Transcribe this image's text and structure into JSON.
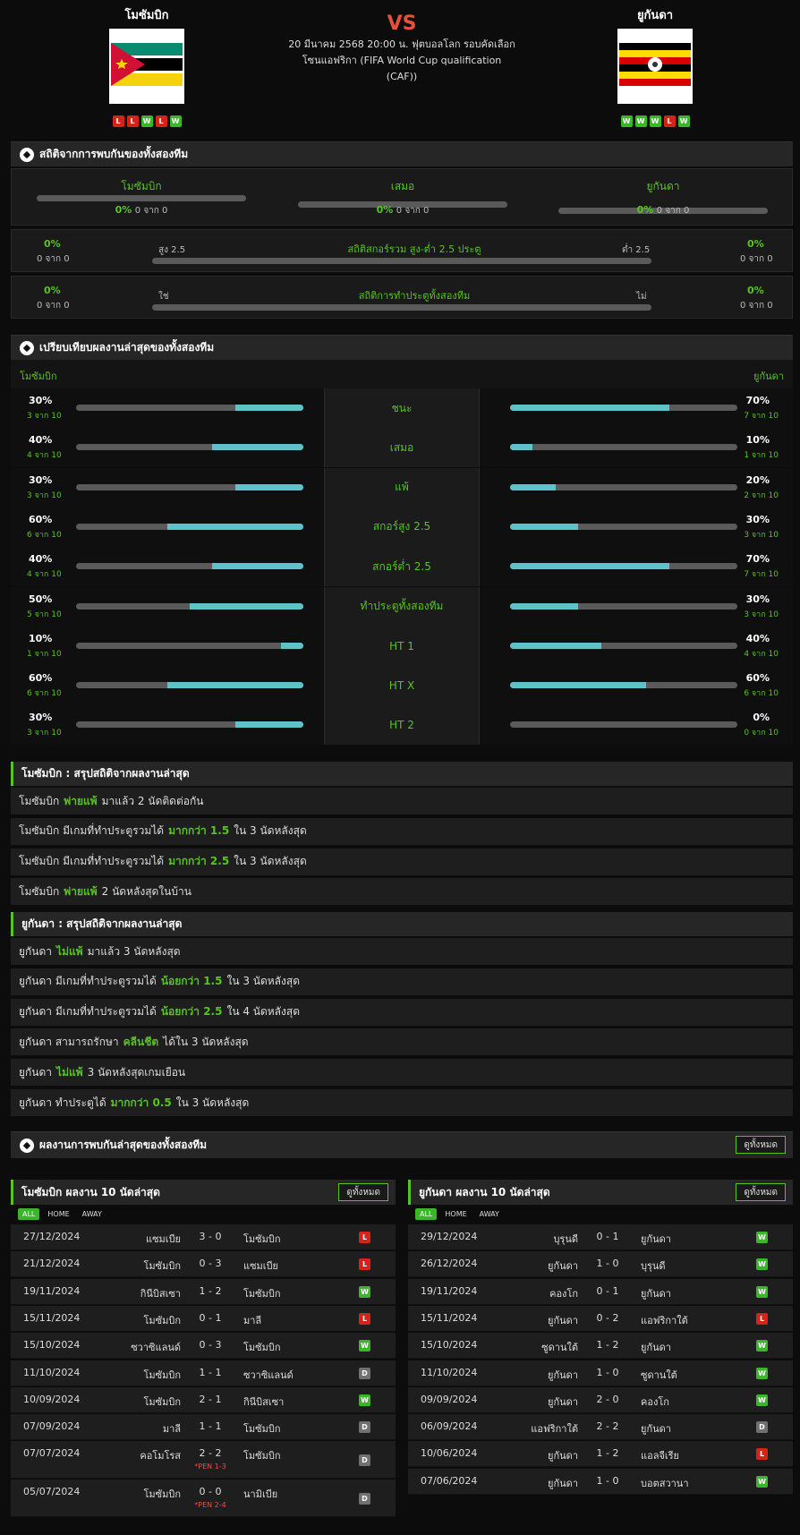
{
  "header": {
    "home_team": "โมซัมบิก",
    "away_team": "ยูกันดา",
    "vs": "VS",
    "match_info": "20 มีนาคม 2568 20:00 น. ฟุตบอลโลก รอบคัดเลือก โซนแอฟริกา (FIFA World Cup qualification (CAF))",
    "home_form": [
      "L",
      "L",
      "W",
      "L",
      "W"
    ],
    "away_form": [
      "W",
      "W",
      "W",
      "L",
      "W"
    ]
  },
  "h2h": {
    "title": "สถิติจากการพบกันของทั้งสองทีม",
    "cols": [
      {
        "label": "โมซัมบิก",
        "pct": "0%",
        "count": "0 จาก 0"
      },
      {
        "label": "เสมอ",
        "pct": "0%",
        "count": "0 จาก 0"
      },
      {
        "label": "ยูกันดา",
        "pct": "0%",
        "count": "0 จาก 0"
      }
    ],
    "ou": {
      "title": "สถิติสกอร์รวม สูง-ต่ำ 2.5 ประตู",
      "left_label": "สูง 2.5",
      "right_label": "ต่ำ 2.5",
      "left_pct": "0%",
      "left_count": "0 จาก 0",
      "right_pct": "0%",
      "right_count": "0 จาก 0"
    },
    "btts": {
      "title": "สถิติการทำประตูทั้งสองทีม",
      "left_label": "ใช่",
      "right_label": "ไม่",
      "left_pct": "0%",
      "left_count": "0 จาก 0",
      "right_pct": "0%",
      "right_count": "0 จาก 0"
    }
  },
  "compare": {
    "title": "เปรียบเทียบผลงานล่าสุดของทั้งสองทีม",
    "home_label": "โมซัมบิก",
    "away_label": "ยูกันดา",
    "rows": [
      {
        "label": "ชนะ",
        "home_pct": "30%",
        "home_count": "3 จาก 10",
        "home_val": 30,
        "away_pct": "70%",
        "away_count": "7 จาก 10",
        "away_val": 70
      },
      {
        "label": "เสมอ",
        "home_pct": "40%",
        "home_count": "4 จาก 10",
        "home_val": 40,
        "away_pct": "10%",
        "away_count": "1 จาก 10",
        "away_val": 10
      },
      {
        "label": "แพ้",
        "home_pct": "30%",
        "home_count": "3 จาก 10",
        "home_val": 30,
        "away_pct": "20%",
        "away_count": "2 จาก 10",
        "away_val": 20
      },
      {
        "label": "สกอร์สูง 2.5",
        "home_pct": "60%",
        "home_count": "6 จาก 10",
        "home_val": 60,
        "away_pct": "30%",
        "away_count": "3 จาก 10",
        "away_val": 30
      },
      {
        "label": "สกอร์ต่ำ 2.5",
        "home_pct": "40%",
        "home_count": "4 จาก 10",
        "home_val": 40,
        "away_pct": "70%",
        "away_count": "7 จาก 10",
        "away_val": 70
      },
      {
        "label": "ทำประตูทั้งสองทีม",
        "home_pct": "50%",
        "home_count": "5 จาก 10",
        "home_val": 50,
        "away_pct": "30%",
        "away_count": "3 จาก 10",
        "away_val": 30
      },
      {
        "label": "HT 1",
        "home_pct": "10%",
        "home_count": "1 จาก 10",
        "home_val": 10,
        "away_pct": "40%",
        "away_count": "4 จาก 10",
        "away_val": 40
      },
      {
        "label": "HT X",
        "home_pct": "60%",
        "home_count": "6 จาก 10",
        "home_val": 60,
        "away_pct": "60%",
        "away_count": "6 จาก 10",
        "away_val": 60
      },
      {
        "label": "HT 2",
        "home_pct": "30%",
        "home_count": "3 จาก 10",
        "home_val": 30,
        "away_pct": "0%",
        "away_count": "0 จาก 10",
        "away_val": 0
      }
    ]
  },
  "home_summary": {
    "title": "โมซัมบิก : สรุปสถิติจากผลงานล่าสุด",
    "rows": [
      {
        "pre": "โมซัมบิก",
        "hl": "พ่ายแพ้",
        "post": "มาแล้ว 2 นัดติดต่อกัน"
      },
      {
        "pre": "โมซัมบิก มีเกมที่ทำประตูรวมได้",
        "hl": "มากกว่า 1.5",
        "post": "ใน 3 นัดหลังสุด"
      },
      {
        "pre": "โมซัมบิก มีเกมที่ทำประตูรวมได้",
        "hl": "มากกว่า 2.5",
        "post": "ใน 3 นัดหลังสุด"
      },
      {
        "pre": "โมซัมบิก",
        "hl": "พ่ายแพ้",
        "post": "2 นัดหลังสุดในบ้าน"
      }
    ]
  },
  "away_summary": {
    "title": "ยูกันดา : สรุปสถิติจากผลงานล่าสุด",
    "rows": [
      {
        "pre": "ยูกันดา",
        "hl": "ไม่แพ้",
        "post": "มาแล้ว 3 นัดหลังสุด"
      },
      {
        "pre": "ยูกันดา มีเกมที่ทำประตูรวมได้",
        "hl": "น้อยกว่า 1.5",
        "post": "ใน 3 นัดหลังสุด"
      },
      {
        "pre": "ยูกันดา มีเกมที่ทำประตูรวมได้",
        "hl": "น้อยกว่า 2.5",
        "post": "ใน 4 นัดหลังสุด"
      },
      {
        "pre": "ยูกันดา สามารถรักษา",
        "hl": "คลีนชีต",
        "post": "ได้ใน 3 นัดหลังสุด"
      },
      {
        "pre": "ยูกันดา",
        "hl": "ไม่แพ้",
        "post": "3 นัดหลังสุดเกมเยือน"
      },
      {
        "pre": "ยูกันดา ทำประตูได้",
        "hl": "มากกว่า 0.5",
        "post": "ใน 3 นัดหลังสุด"
      }
    ]
  },
  "h2h_results": {
    "title": "ผลงานการพบกันล่าสุดของทั้งสองทีม",
    "see_all": "ดูทั้งหมด"
  },
  "tabs": [
    "ALL",
    "HOME",
    "AWAY"
  ],
  "home_results": {
    "title": "โมซัมบิก ผลงาน 10 นัดล่าสุด",
    "see_all": "ดูทั้งหมด",
    "rows": [
      {
        "date": "27/12/2024",
        "home": "แซมเบีย",
        "score": "3 - 0",
        "away": "โมซัมบิก",
        "res": "L"
      },
      {
        "date": "21/12/2024",
        "home": "โมซัมบิก",
        "score": "0 - 3",
        "away": "แซมเบีย",
        "res": "L"
      },
      {
        "date": "19/11/2024",
        "home": "กินีบิสเซา",
        "score": "1 - 2",
        "away": "โมซัมบิก",
        "res": "W"
      },
      {
        "date": "15/11/2024",
        "home": "โมซัมบิก",
        "score": "0 - 1",
        "away": "มาลี",
        "res": "L"
      },
      {
        "date": "15/10/2024",
        "home": "ซวาซิแลนด์",
        "score": "0 - 3",
        "away": "โมซัมบิก",
        "res": "W"
      },
      {
        "date": "11/10/2024",
        "home": "โมซัมบิก",
        "score": "1 - 1",
        "away": "ซวาซิแลนด์",
        "res": "D"
      },
      {
        "date": "10/09/2024",
        "home": "โมซัมบิก",
        "score": "2 - 1",
        "away": "กินีบิสเซา",
        "res": "W"
      },
      {
        "date": "07/09/2024",
        "home": "มาลี",
        "score": "1 - 1",
        "away": "โมซัมบิก",
        "res": "D"
      },
      {
        "date": "07/07/2024",
        "home": "คอโมโรส",
        "score": "2 - 2",
        "pen": "*PEN 1-3",
        "away": "โมซัมบิก",
        "res": "D"
      },
      {
        "date": "05/07/2024",
        "home": "โมซัมบิก",
        "score": "0 - 0",
        "pen": "*PEN 2-4",
        "away": "นามิเบีย",
        "res": "D"
      }
    ]
  },
  "away_results": {
    "title": "ยูกันดา ผลงาน 10 นัดล่าสุด",
    "see_all": "ดูทั้งหมด",
    "rows": [
      {
        "date": "29/12/2024",
        "home": "บุรุนดี",
        "score": "0 - 1",
        "away": "ยูกันดา",
        "res": "W"
      },
      {
        "date": "26/12/2024",
        "home": "ยูกันดา",
        "score": "1 - 0",
        "away": "บุรุนดี",
        "res": "W"
      },
      {
        "date": "19/11/2024",
        "home": "คองโก",
        "score": "0 - 1",
        "away": "ยูกันดา",
        "res": "W"
      },
      {
        "date": "15/11/2024",
        "home": "ยูกันดา",
        "score": "0 - 2",
        "away": "แอฟริกาใต้",
        "res": "L"
      },
      {
        "date": "15/10/2024",
        "home": "ซูดานใต้",
        "score": "1 - 2",
        "away": "ยูกันดา",
        "res": "W"
      },
      {
        "date": "11/10/2024",
        "home": "ยูกันดา",
        "score": "1 - 0",
        "away": "ซูดานใต้",
        "res": "W"
      },
      {
        "date": "09/09/2024",
        "home": "ยูกันดา",
        "score": "2 - 0",
        "away": "คองโก",
        "res": "W"
      },
      {
        "date": "06/09/2024",
        "home": "แอฟริกาใต้",
        "score": "2 - 2",
        "away": "ยูกันดา",
        "res": "D"
      },
      {
        "date": "10/06/2024",
        "home": "ยูกันดา",
        "score": "1 - 2",
        "away": "แอลจีเรีย",
        "res": "L"
      },
      {
        "date": "07/06/2024",
        "home": "ยูกันดา",
        "score": "1 - 0",
        "away": "บอตสวานา",
        "res": "W"
      }
    ]
  }
}
